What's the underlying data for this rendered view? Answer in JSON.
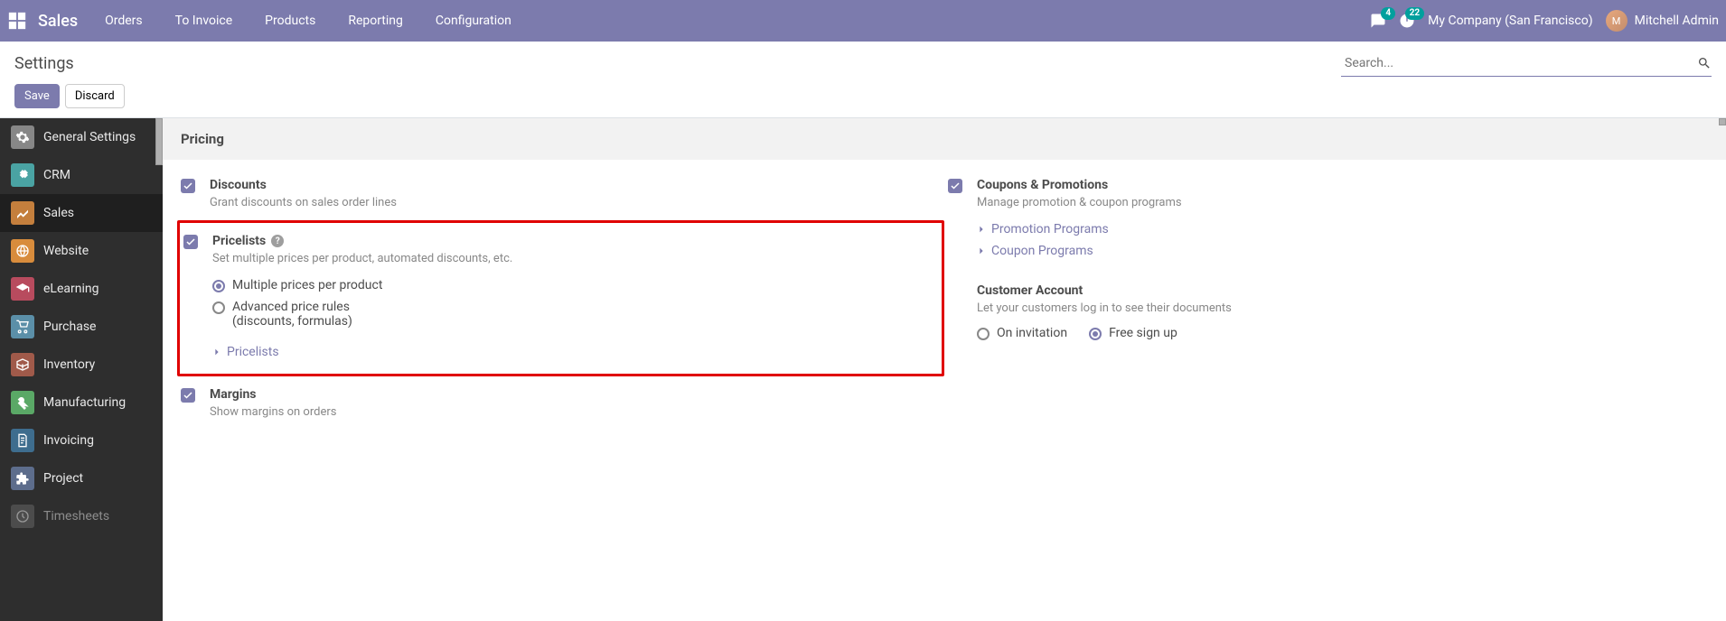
{
  "navbar": {
    "brand": "Sales",
    "menu": [
      "Orders",
      "To Invoice",
      "Products",
      "Reporting",
      "Configuration"
    ],
    "msg_badge": "4",
    "act_badge": "22",
    "company": "My Company (San Francisco)",
    "user": "Mitchell Admin"
  },
  "control": {
    "breadcrumb": "Settings",
    "search_ph": "Search...",
    "save": "Save",
    "discard": "Discard"
  },
  "sidebar": {
    "items": [
      {
        "label": "General Settings",
        "color": "#878787"
      },
      {
        "label": "CRM",
        "color": "#4aa3a3"
      },
      {
        "label": "Sales",
        "color": "#c47f3d",
        "active": true
      },
      {
        "label": "Website",
        "color": "#d88c3c"
      },
      {
        "label": "eLearning",
        "color": "#b84b5e"
      },
      {
        "label": "Purchase",
        "color": "#5b8fa8"
      },
      {
        "label": "Inventory",
        "color": "#a05a4a"
      },
      {
        "label": "Manufacturing",
        "color": "#5aa866"
      },
      {
        "label": "Invoicing",
        "color": "#3e6d8e"
      },
      {
        "label": "Project",
        "color": "#5d6d8c"
      },
      {
        "label": "Timesheets",
        "color": "#6b6b6b"
      }
    ]
  },
  "section": {
    "title": "Pricing"
  },
  "settings": {
    "discounts": {
      "title": "Discounts",
      "desc": "Grant discounts on sales order lines"
    },
    "pricelists": {
      "title": "Pricelists",
      "desc": "Set multiple prices per product, automated discounts, etc.",
      "opt1": "Multiple prices per product",
      "opt2": "Advanced price rules",
      "opt2b": "(discounts, formulas)",
      "link": "Pricelists"
    },
    "margins": {
      "title": "Margins",
      "desc": "Show margins on orders"
    },
    "coupons": {
      "title": "Coupons & Promotions",
      "desc": "Manage promotion & coupon programs",
      "link1": "Promotion Programs",
      "link2": "Coupon Programs"
    },
    "customer": {
      "title": "Customer Account",
      "desc": "Let your customers log in to see their documents",
      "opt1": "On invitation",
      "opt2": "Free sign up"
    }
  }
}
